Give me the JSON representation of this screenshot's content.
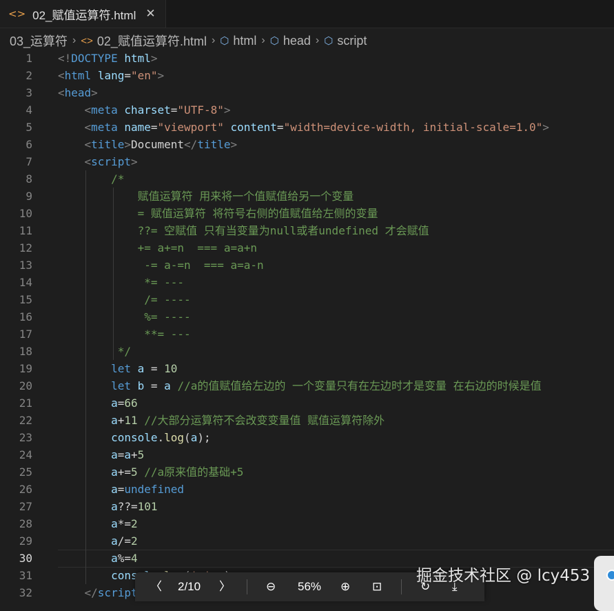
{
  "tab": {
    "icon": "html-file-icon",
    "filename": "02_赋值运算符.html",
    "close": "✕"
  },
  "breadcrumbs": [
    {
      "label": "03_运算符",
      "icon": ""
    },
    {
      "label": "02_赋值运算符.html",
      "icon": "html-file-icon"
    },
    {
      "label": "html",
      "icon": "cube-icon"
    },
    {
      "label": "head",
      "icon": "cube-icon"
    },
    {
      "label": "script",
      "icon": "cube-icon"
    }
  ],
  "editor": {
    "current_line": 30,
    "lines": [
      [
        [
          "pun",
          "<!"
        ],
        [
          "tag",
          "DOCTYPE"
        ],
        [
          "txt",
          " "
        ],
        [
          "attr",
          "html"
        ],
        [
          "pun",
          ">"
        ]
      ],
      [
        [
          "pun",
          "<"
        ],
        [
          "tag",
          "html"
        ],
        [
          "txt",
          " "
        ],
        [
          "attr",
          "lang"
        ],
        [
          "txt",
          "="
        ],
        [
          "str",
          "\"en\""
        ],
        [
          "pun",
          ">"
        ]
      ],
      [
        [
          "pun",
          "<"
        ],
        [
          "tag",
          "head"
        ],
        [
          "pun",
          ">"
        ]
      ],
      [
        [
          "txt",
          "    "
        ],
        [
          "pun",
          "<"
        ],
        [
          "tag",
          "meta"
        ],
        [
          "txt",
          " "
        ],
        [
          "attr",
          "charset"
        ],
        [
          "txt",
          "="
        ],
        [
          "str",
          "\"UTF-8\""
        ],
        [
          "pun",
          ">"
        ]
      ],
      [
        [
          "txt",
          "    "
        ],
        [
          "pun",
          "<"
        ],
        [
          "tag",
          "meta"
        ],
        [
          "txt",
          " "
        ],
        [
          "attr",
          "name"
        ],
        [
          "txt",
          "="
        ],
        [
          "str",
          "\"viewport\""
        ],
        [
          "txt",
          " "
        ],
        [
          "attr",
          "content"
        ],
        [
          "txt",
          "="
        ],
        [
          "str",
          "\"width=device-width, initial-scale=1.0\""
        ],
        [
          "pun",
          ">"
        ]
      ],
      [
        [
          "txt",
          "    "
        ],
        [
          "pun",
          "<"
        ],
        [
          "tag",
          "title"
        ],
        [
          "pun",
          ">"
        ],
        [
          "txt",
          "Document"
        ],
        [
          "pun",
          "</"
        ],
        [
          "tag",
          "title"
        ],
        [
          "pun",
          ">"
        ]
      ],
      [
        [
          "txt",
          "    "
        ],
        [
          "pun",
          "<"
        ],
        [
          "tag",
          "script"
        ],
        [
          "pun",
          ">"
        ]
      ],
      [
        [
          "cmt",
          "        /*"
        ]
      ],
      [
        [
          "cmt",
          "            赋值运算符 用来将一个值赋值给另一个变量"
        ]
      ],
      [
        [
          "cmt",
          "            = 赋值运算符 将符号右侧的值赋值给左侧的变量"
        ]
      ],
      [
        [
          "cmt",
          "            ??= 空赋值 只有当变量为null或者undefined 才会赋值"
        ]
      ],
      [
        [
          "cmt",
          "            += a+=n  === a=a+n"
        ]
      ],
      [
        [
          "cmt",
          "             -= a-=n  === a=a-n"
        ]
      ],
      [
        [
          "cmt",
          "             *= ---"
        ]
      ],
      [
        [
          "cmt",
          "             /= ----"
        ]
      ],
      [
        [
          "cmt",
          "             %= ----"
        ]
      ],
      [
        [
          "cmt",
          "             **= ---"
        ]
      ],
      [
        [
          "cmt",
          "         */"
        ]
      ],
      [
        [
          "txt",
          "        "
        ],
        [
          "kw",
          "let"
        ],
        [
          "txt",
          " "
        ],
        [
          "var",
          "a"
        ],
        [
          "txt",
          " = "
        ],
        [
          "num",
          "10"
        ]
      ],
      [
        [
          "txt",
          "        "
        ],
        [
          "kw",
          "let"
        ],
        [
          "txt",
          " "
        ],
        [
          "var",
          "b"
        ],
        [
          "txt",
          " = "
        ],
        [
          "var",
          "a"
        ],
        [
          "txt",
          " "
        ],
        [
          "cmt",
          "//a的值赋值给左边的 一个变量只有在左边时才是变量 在右边的时候是值"
        ]
      ],
      [
        [
          "txt",
          "        "
        ],
        [
          "var",
          "a"
        ],
        [
          "txt",
          "="
        ],
        [
          "num",
          "66"
        ]
      ],
      [
        [
          "txt",
          "        "
        ],
        [
          "var",
          "a"
        ],
        [
          "txt",
          "+"
        ],
        [
          "num",
          "11"
        ],
        [
          "txt",
          " "
        ],
        [
          "cmt",
          "//大部分运算符不会改变变量值 赋值运算符除外"
        ]
      ],
      [
        [
          "txt",
          "        "
        ],
        [
          "var",
          "console"
        ],
        [
          "txt",
          "."
        ],
        [
          "fn",
          "log"
        ],
        [
          "txt",
          "("
        ],
        [
          "var",
          "a"
        ],
        [
          "txt",
          ");"
        ]
      ],
      [
        [
          "txt",
          "        "
        ],
        [
          "var",
          "a"
        ],
        [
          "txt",
          "="
        ],
        [
          "var",
          "a"
        ],
        [
          "txt",
          "+"
        ],
        [
          "num",
          "5"
        ]
      ],
      [
        [
          "txt",
          "        "
        ],
        [
          "var",
          "a"
        ],
        [
          "txt",
          "+="
        ],
        [
          "num",
          "5"
        ],
        [
          "txt",
          " "
        ],
        [
          "cmt",
          "//a原来值的基础+5"
        ]
      ],
      [
        [
          "txt",
          "        "
        ],
        [
          "var",
          "a"
        ],
        [
          "txt",
          "="
        ],
        [
          "kw",
          "undefined"
        ]
      ],
      [
        [
          "txt",
          "        "
        ],
        [
          "var",
          "a"
        ],
        [
          "txt",
          "??="
        ],
        [
          "num",
          "101"
        ]
      ],
      [
        [
          "txt",
          "        "
        ],
        [
          "var",
          "a"
        ],
        [
          "txt",
          "*="
        ],
        [
          "num",
          "2"
        ]
      ],
      [
        [
          "txt",
          "        "
        ],
        [
          "var",
          "a"
        ],
        [
          "txt",
          "/="
        ],
        [
          "num",
          "2"
        ]
      ],
      [
        [
          "txt",
          "        "
        ],
        [
          "var",
          "a"
        ],
        [
          "txt",
          "%="
        ],
        [
          "num",
          "4"
        ]
      ],
      [
        [
          "txt",
          "        "
        ],
        [
          "var",
          "console"
        ],
        [
          "txt",
          "."
        ],
        [
          "fn",
          "log"
        ],
        [
          "txt",
          "("
        ],
        [
          "str",
          "'a'"
        ],
        [
          "txt",
          ","
        ],
        [
          "var",
          "a"
        ],
        [
          "txt",
          ")"
        ]
      ],
      [
        [
          "txt",
          "    "
        ],
        [
          "pun",
          "</"
        ],
        [
          "tag",
          "script"
        ],
        [
          "pun",
          ">"
        ]
      ]
    ]
  },
  "pdf_toolbar": {
    "page_indicator": "2/10",
    "zoom": "56%",
    "icons": [
      "chevron-left-icon",
      "chevron-right-icon",
      "zoom-out-icon",
      "zoom-in-icon",
      "fit-page-icon",
      "rotate-icon",
      "download-icon"
    ]
  },
  "watermark": "掘金技术社区 @ lcy453"
}
